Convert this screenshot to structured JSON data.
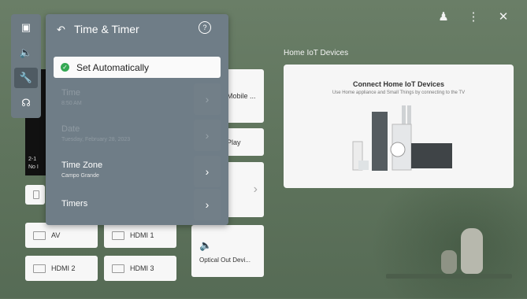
{
  "panel": {
    "title": "Time & Timer",
    "set_automatically": "Set Automatically",
    "items": [
      {
        "label": "Time",
        "sub": "8:50 AM"
      },
      {
        "label": "Date",
        "sub": "Tuesday, February 28, 2023"
      },
      {
        "label": "Time Zone",
        "sub": "Campo Grande"
      },
      {
        "label": "Timers",
        "sub": ""
      }
    ]
  },
  "iot": {
    "title": "Home IoT Devices",
    "card_heading": "Connect Home IoT Devices",
    "card_sub": "Use Home appliance and Small Things by connecting to the TV"
  },
  "tiles": {
    "mobile": "Mobile ...",
    "play": "Play",
    "av": "AV",
    "hdmi1": "HDMI 1",
    "hdmi2": "HDMI 2",
    "hdmi3": "HDMI 3",
    "optical": "Optical Out Devi..."
  },
  "side_show": {
    "line1": "2-1",
    "line2": "No I"
  },
  "icons": [
    "settings-icon",
    "sound-icon",
    "general-icon",
    "support-icon",
    "account-icon",
    "more-icon",
    "close-icon"
  ]
}
